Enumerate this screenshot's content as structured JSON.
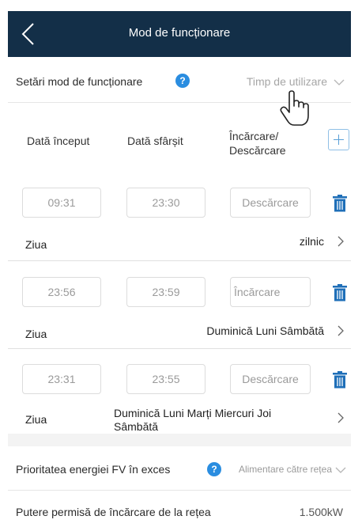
{
  "header": {
    "title": "Mod de funcționare"
  },
  "settings": {
    "label": "Setări mod de funcționare",
    "value": "Timp de utilizare"
  },
  "columns": {
    "start": "Dată început",
    "end": "Dată sfârșit",
    "mode_line1": "Încărcare/",
    "mode_line2": "Descărcare"
  },
  "schedules": [
    {
      "start": "09:31",
      "end": "23:30",
      "mode": "Descărcare",
      "day_label": "Ziua",
      "days": "zilnic"
    },
    {
      "start": "23:56",
      "end": "23:59",
      "mode": "Încărcare",
      "day_label": "Ziua",
      "days": "Duminică  Luni  Sâmbătă"
    },
    {
      "start": "23:31",
      "end": "23:55",
      "mode": "Descărcare",
      "day_label": "Ziua",
      "days_line1": "Duminică  Luni  Marți  Miercuri  Joi",
      "days_line2": "Sâmbătă"
    }
  ],
  "excess": {
    "label": "Prioritatea energiei FV în exces",
    "value": "Alimentare către rețea"
  },
  "grid_charge": {
    "label": "Putere permisă de încărcare de la rețea",
    "value": "1.500kW"
  },
  "colors": {
    "header_bg": "#132f48",
    "accent": "#2a8de0",
    "trash": "#1f6fb8"
  },
  "icons": [
    "back-arrow-icon",
    "help-icon",
    "chevron-down-icon",
    "hand-pointer-icon",
    "plus-icon",
    "trash-icon",
    "chevron-right-icon"
  ]
}
